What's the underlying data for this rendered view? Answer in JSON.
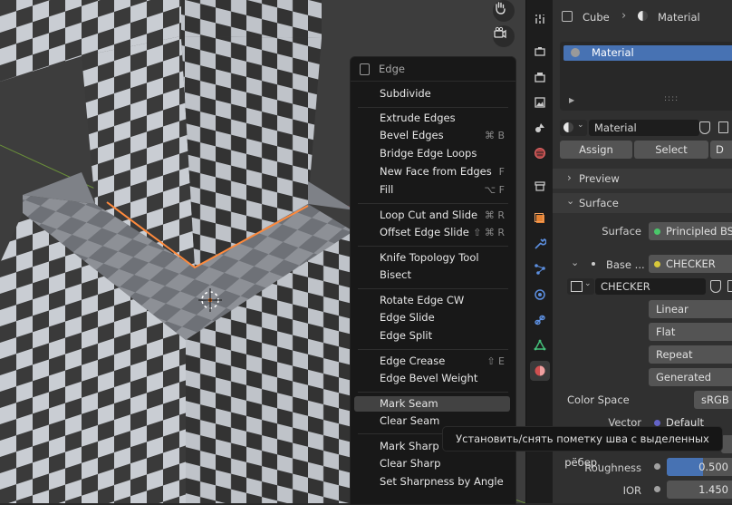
{
  "colors": {
    "accent": "#4772b3",
    "seam_edge": "#ff8a3c",
    "menu_bg": "#181818",
    "panel_bg": "#303030"
  },
  "viewport": {
    "nav_icons": [
      {
        "icon": "hand-pan-icon"
      },
      {
        "icon": "camera-icon"
      }
    ]
  },
  "menu": {
    "title": "Edge",
    "items": [
      {
        "label": "Subdivide",
        "shortcut": ""
      },
      {
        "label": "Extrude Edges",
        "shortcut": ""
      },
      {
        "label": "Bevel Edges",
        "shortcut": "⌘ B"
      },
      {
        "label": "Bridge Edge Loops",
        "shortcut": ""
      },
      {
        "label": "New Face from Edges",
        "shortcut": "F"
      },
      {
        "label": "Fill",
        "shortcut": "⌥ F"
      },
      {
        "label": "Loop Cut and Slide",
        "shortcut": "⌘ R"
      },
      {
        "label": "Offset Edge Slide",
        "shortcut": "⇧ ⌘ R"
      },
      {
        "label": "Knife Topology Tool",
        "shortcut": ""
      },
      {
        "label": "Bisect",
        "shortcut": ""
      },
      {
        "label": "Rotate Edge CW",
        "shortcut": ""
      },
      {
        "label": "Edge Slide",
        "shortcut": ""
      },
      {
        "label": "Edge Split",
        "shortcut": ""
      },
      {
        "label": "Edge Crease",
        "shortcut": "⇧ E"
      },
      {
        "label": "Edge Bevel Weight",
        "shortcut": ""
      },
      {
        "label": "Mark Seam",
        "shortcut": ""
      },
      {
        "label": "Clear Seam",
        "shortcut": ""
      },
      {
        "label": "Mark Sharp",
        "shortcut": ""
      },
      {
        "label": "Clear Sharp",
        "shortcut": ""
      },
      {
        "label": "Set Sharpness by Angle",
        "shortcut": ""
      }
    ],
    "highlighted": "Mark Seam"
  },
  "tooltip": {
    "text": "Установить/снять пометку шва с выделенных рёбер."
  },
  "properties": {
    "breadcrumb": {
      "object": "Cube",
      "material": "Material"
    },
    "slot": {
      "name": "Material"
    },
    "material_name": "Material",
    "buttons": {
      "assign": "Assign",
      "select": "Select",
      "deselect": "D"
    },
    "panels": {
      "preview": "Preview",
      "surface": "Surface"
    },
    "surface": {
      "label": "Surface",
      "value": "Principled BS"
    },
    "base_color": {
      "label": "Base ...",
      "value": "CHECKER"
    },
    "image": {
      "name": "CHECKER"
    },
    "interpolation": "Linear",
    "projection": "Flat",
    "extension": "Repeat",
    "source": "Generated",
    "color_space": {
      "label": "Color Space",
      "value": "sRGB"
    },
    "vector": {
      "label": "Vector",
      "value": "Default"
    },
    "roughness": {
      "label": "Roughness",
      "value": "0.500",
      "fill": 0.5
    },
    "ior": {
      "label": "IOR",
      "value": "1.450"
    }
  }
}
